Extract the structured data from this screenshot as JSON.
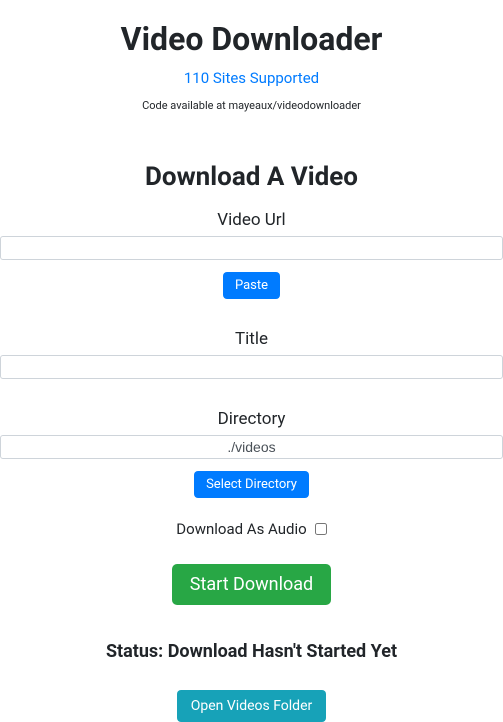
{
  "header": {
    "title": "Video Downloader",
    "sites_link": "110 Sites Supported",
    "code_info": "Code available at mayeaux/videodownloader"
  },
  "section": {
    "heading": "Download A Video"
  },
  "fields": {
    "video_url": {
      "label": "Video Url",
      "value": ""
    },
    "title": {
      "label": "Title",
      "value": ""
    },
    "directory": {
      "label": "Directory",
      "value": "./videos"
    }
  },
  "buttons": {
    "paste": "Paste",
    "select_directory": "Select Directory",
    "start_download": "Start Download",
    "open_folder": "Open Videos Folder"
  },
  "checkbox": {
    "label": "Download As Audio",
    "checked": false
  },
  "status": {
    "text": "Status: Download Hasn't Started Yet"
  }
}
